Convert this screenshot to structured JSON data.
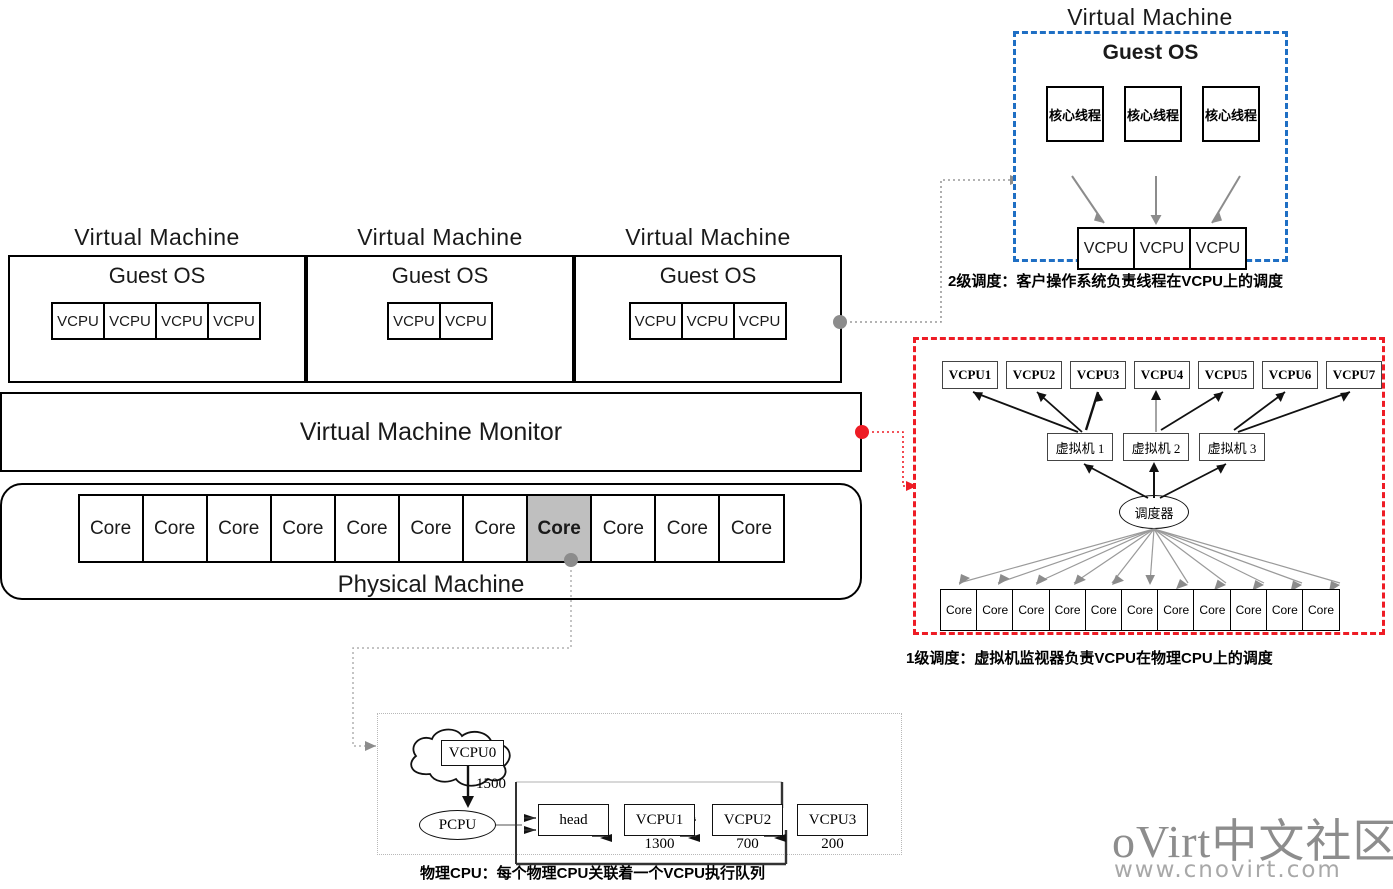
{
  "left": {
    "vms": [
      {
        "title": "Virtual  Machine",
        "guest_label": "Guest OS",
        "vcpus": [
          "VCPU",
          "VCPU",
          "VCPU",
          "VCPU"
        ]
      },
      {
        "title": "Virtual  Machine",
        "guest_label": "Guest OS",
        "vcpus": [
          "VCPU",
          "VCPU"
        ]
      },
      {
        "title": "Virtual  Machine",
        "guest_label": "Guest OS",
        "vcpus": [
          "VCPU",
          "VCPU",
          "VCPU"
        ]
      }
    ],
    "vmm_label": "Virtual Machine Monitor",
    "physical_machine_label": "Physical Machine",
    "cores": [
      "Core",
      "Core",
      "Core",
      "Core",
      "Core",
      "Core",
      "Core",
      "Core",
      "Core",
      "Core",
      "Core"
    ],
    "highlighted_core_index": 7
  },
  "level2_panel": {
    "title": "Virtual  Machine",
    "guest_label": "Guest OS",
    "threads": [
      "核心线程",
      "核心线程",
      "核心线程"
    ],
    "vcpus": [
      "VCPU",
      "VCPU",
      "VCPU"
    ],
    "caption": "2级调度：客户操作系统负责线程在VCPU上的调度",
    "border_color": "#1f6fc4"
  },
  "level1_panel": {
    "vcpus": [
      "VCPU1",
      "VCPU2",
      "VCPU3",
      "VCPU4",
      "VCPU5",
      "VCPU6",
      "VCPU7"
    ],
    "vms": [
      "虚拟机 1",
      "虚拟机 2",
      "虚拟机 3"
    ],
    "scheduler": "调度器",
    "cores": [
      "Core",
      "Core",
      "Core",
      "Core",
      "Core",
      "Core",
      "Core",
      "Core",
      "Core",
      "Core",
      "Core"
    ],
    "caption": "1级调度：虚拟机监视器负责VCPU在物理CPU上的调度",
    "border_color": "#ee1c25"
  },
  "pcpu_panel": {
    "cloud_label": "VCPU0",
    "cloud_weight": "1500",
    "pcpu_label": "PCPU",
    "queue": [
      {
        "label": "head",
        "weight": ""
      },
      {
        "label": "VCPU1",
        "weight": "1300"
      },
      {
        "label": "VCPU2",
        "weight": "700"
      },
      {
        "label": "VCPU3",
        "weight": "200"
      }
    ],
    "caption": "物理CPU：每个物理CPU关联着一个VCPU执行队列"
  },
  "watermark": {
    "line1": "oVirt中文社区",
    "line2": "www.cnovirt.com"
  },
  "colors": {
    "highlight": "#bfbfbf",
    "connector_gray": "#9a9a9a",
    "connector_red": "#ee1c25"
  }
}
